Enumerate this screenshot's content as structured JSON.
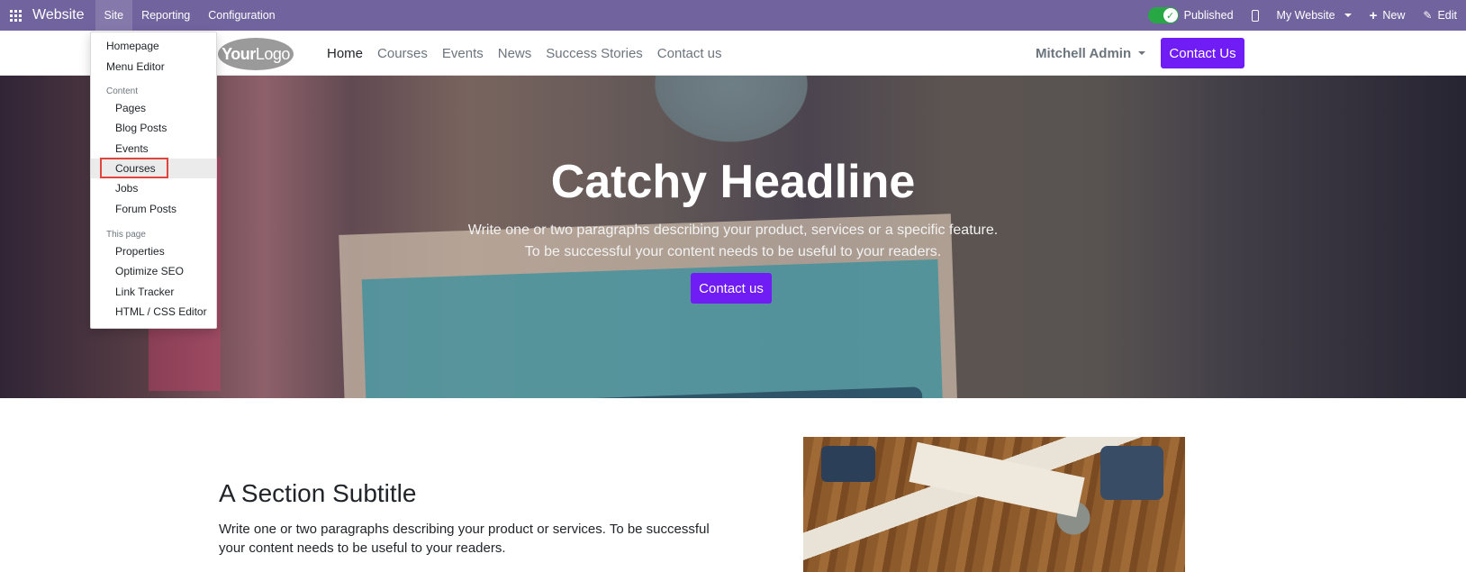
{
  "adminbar": {
    "brand": "Website",
    "menus": [
      "Site",
      "Reporting",
      "Configuration"
    ],
    "published_label": "Published",
    "website_label": "My Website",
    "new_label": "New",
    "edit_label": "Edit",
    "color": "#71639e"
  },
  "navbar": {
    "logo_bold": "Your",
    "logo_light": "Logo",
    "links": [
      "Home",
      "Courses",
      "Events",
      "News",
      "Success Stories",
      "Contact us"
    ],
    "user": "Mitchell Admin",
    "cta": "Contact Us",
    "accent": "#6f1cf5"
  },
  "dropdown": {
    "homepage": "Homepage",
    "menu_editor": "Menu Editor",
    "content_header": "Content",
    "content_items": [
      "Pages",
      "Blog Posts",
      "Events",
      "Courses",
      "Jobs",
      "Forum Posts"
    ],
    "thispage_header": "This page",
    "thispage_items": [
      "Properties",
      "Optimize SEO",
      "Link Tracker",
      "HTML / CSS Editor"
    ]
  },
  "hero": {
    "headline": "Catchy Headline",
    "line1": "Write one or two paragraphs describing your product, services or a specific feature.",
    "line2": "To be successful your content needs to be useful to your readers.",
    "cta": "Contact us"
  },
  "section": {
    "subtitle": "A Section Subtitle",
    "text": "Write one or two paragraphs describing your product or services. To be successful your content needs to be useful to your readers."
  }
}
